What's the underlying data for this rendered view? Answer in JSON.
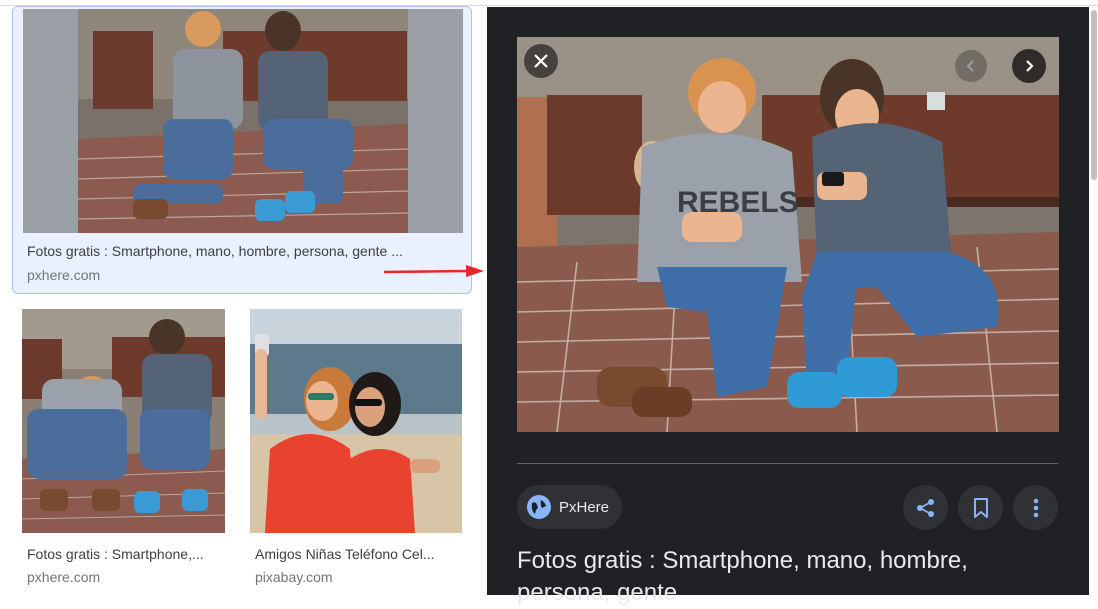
{
  "results": [
    {
      "title": "Fotos gratis : Smartphone, mano, hombre, persona, gente ...",
      "source": "pxhere.com",
      "selected": true
    },
    {
      "title": "Fotos gratis : Smartphone,...",
      "source": "pxhere.com",
      "selected": false
    },
    {
      "title": "Amigos Niñas Teléfono Cel...",
      "source": "pixabay.com",
      "selected": false
    }
  ],
  "preview": {
    "source_name": "PxHere",
    "title": "Fotos gratis : Smartphone, mano, hombre, persona, gente",
    "icons": {
      "close": "close-icon",
      "prev": "chevron-left-icon",
      "next": "chevron-right-icon",
      "source": "globe-icon",
      "share": "share-icon",
      "save": "bookmark-icon",
      "more": "more-vert-icon"
    }
  },
  "colors": {
    "panel_bg": "#202124",
    "selected_card_bg": "#e9f1fe",
    "arrow": "#e8262b",
    "accent": "#8ab4f8"
  }
}
